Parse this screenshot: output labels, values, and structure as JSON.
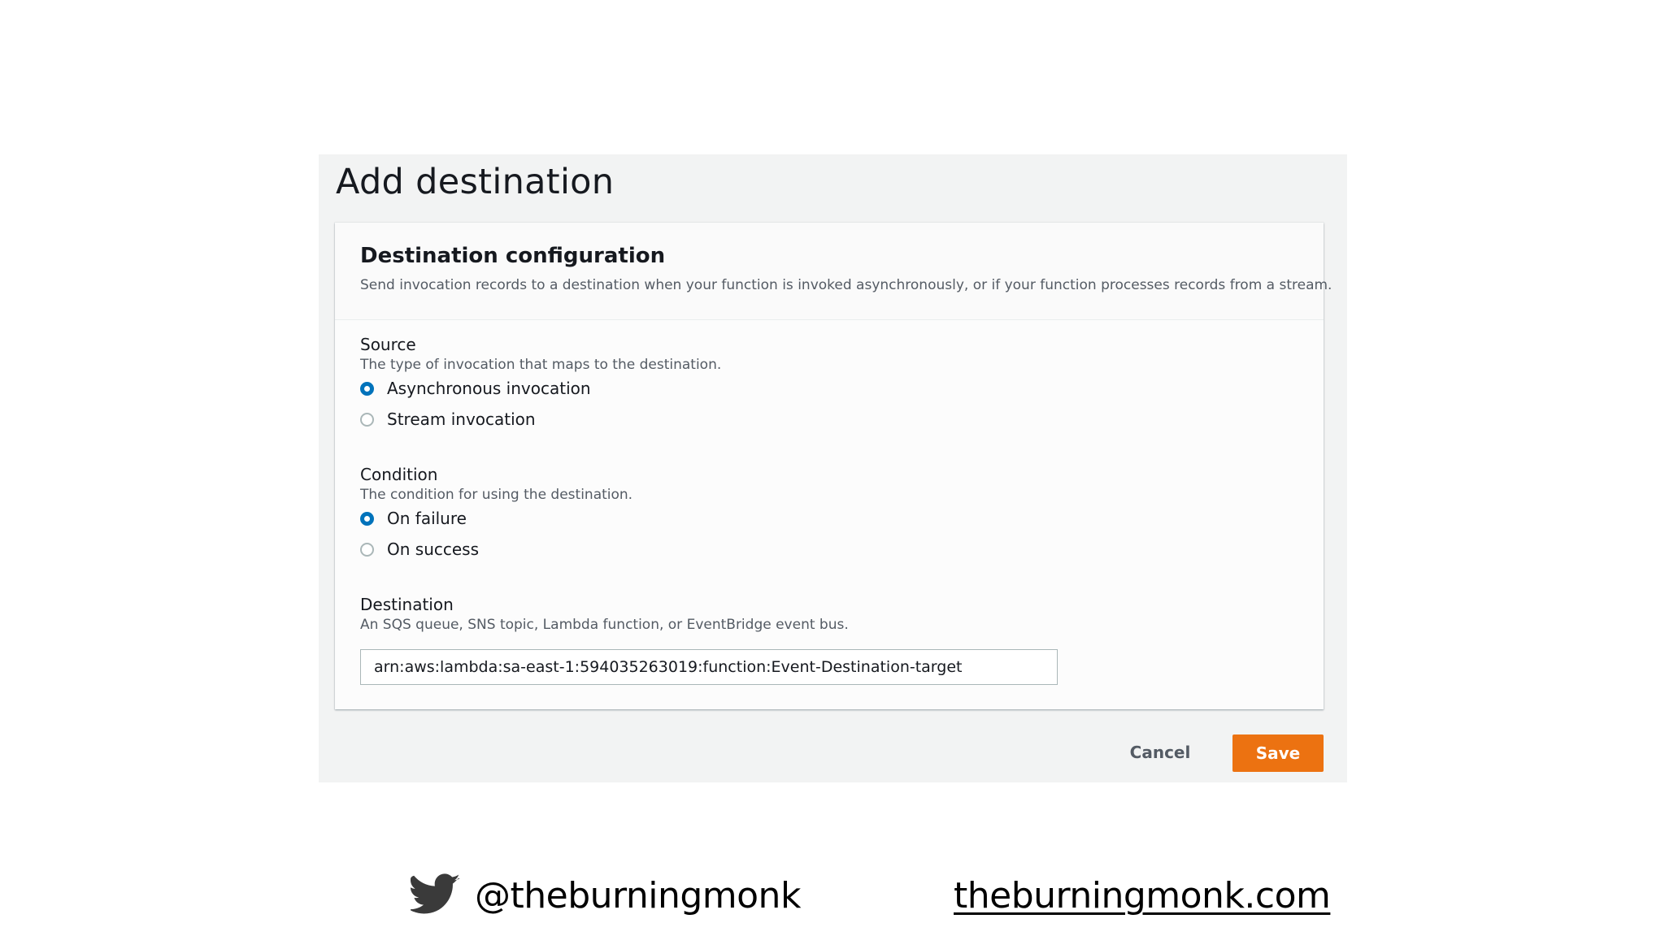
{
  "dialog": {
    "title": "Add destination",
    "card": {
      "title": "Destination configuration",
      "description": "Send invocation records to a destination when your function is invoked asynchronously, or if your function processes records from a stream."
    },
    "source": {
      "label": "Source",
      "hint": "The type of invocation that maps to the destination.",
      "options": [
        {
          "label": "Asynchronous invocation",
          "selected": true
        },
        {
          "label": "Stream invocation",
          "selected": false
        }
      ]
    },
    "condition": {
      "label": "Condition",
      "hint": "The condition for using the destination.",
      "options": [
        {
          "label": "On failure",
          "selected": true
        },
        {
          "label": "On success",
          "selected": false
        }
      ]
    },
    "destination": {
      "label": "Destination",
      "hint": "An SQS queue, SNS topic, Lambda function, or EventBridge event bus.",
      "value": "arn:aws:lambda:sa-east-1:594035263019:function:Event-Destination-target"
    },
    "buttons": {
      "cancel": "Cancel",
      "save": "Save"
    }
  },
  "footer": {
    "twitter_icon": "twitter-bird-icon",
    "twitter_handle": "@theburningmonk",
    "website": "theburningmonk.com"
  },
  "colors": {
    "accent": "#0073bb",
    "save_button": "#ec7211",
    "panel_background": "#f2f3f3"
  }
}
